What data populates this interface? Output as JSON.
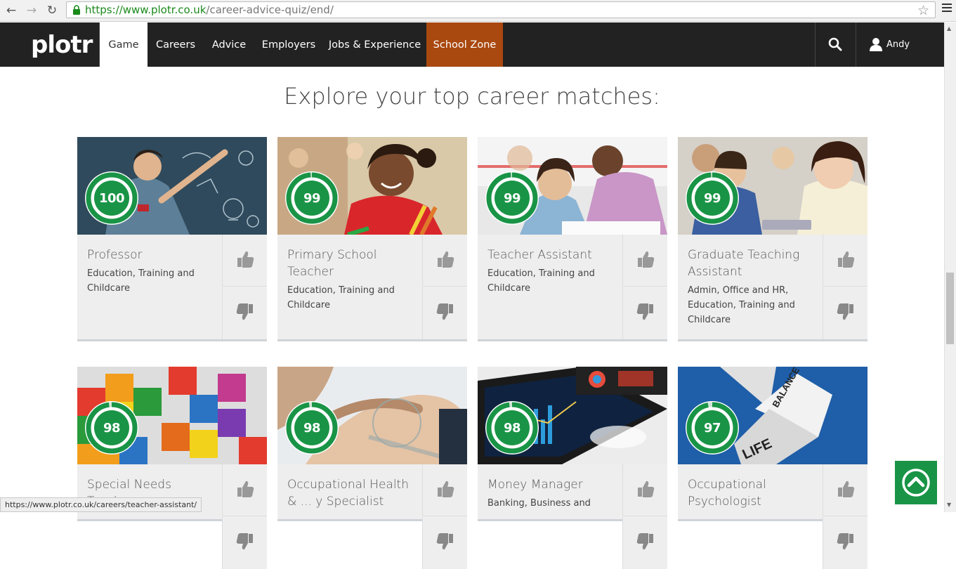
{
  "browser": {
    "url_host": "https://www.plotr.co.uk",
    "url_path": "/career-advice-quiz/end/",
    "status_url": "https://www.plotr.co.uk/careers/teacher-assistant/"
  },
  "site": {
    "logo": "plotr",
    "nav": [
      {
        "label": "Game",
        "active": true
      },
      {
        "label": "Careers"
      },
      {
        "label": "Advice"
      },
      {
        "label": "Employers"
      },
      {
        "label": "Jobs & Experience"
      },
      {
        "label": "School Zone"
      }
    ],
    "user_name": "Andy",
    "icons": {
      "search": "search-icon",
      "user": "user-icon",
      "back_to_top": "arrow-up-circle-icon"
    }
  },
  "page": {
    "heading": "Explore your top career matches:"
  },
  "colors": {
    "header_bg": "#222222",
    "school_zone": "#a9480f",
    "score_green": "#199446",
    "card_bg": "#eeeeee"
  },
  "cards": [
    {
      "score": "100",
      "score_pct": 100,
      "title": "Professor",
      "category": "Education, Training and Childcare",
      "image": "teacher-at-chalkboard"
    },
    {
      "score": "99",
      "score_pct": 99,
      "title": "Primary School Teacher",
      "category": "Education, Training and Childcare",
      "image": "smiling-girl-in-class"
    },
    {
      "score": "99",
      "score_pct": 99,
      "title": "Teacher Assistant",
      "category": "Education, Training and Childcare",
      "image": "teacher-helping-student"
    },
    {
      "score": "99",
      "score_pct": 99,
      "title": "Graduate Teaching Assistant",
      "category": "Admin, Office and HR, Education, Training and Childcare",
      "image": "teacher-with-pupils"
    },
    {
      "score": "98",
      "score_pct": 98,
      "title": "Special Needs Teacher",
      "category": "",
      "image": "colourful-puzzle-cube"
    },
    {
      "score": "98",
      "score_pct": 98,
      "title": "Occupational Health & Safety Specialist",
      "title_visible": "Occupational Health & ... y Specialist",
      "category": "",
      "image": "knee-protractor"
    },
    {
      "score": "98",
      "score_pct": 98,
      "title": "Money Manager",
      "category": "Banking, Business and",
      "image": "tablet-with-charts"
    },
    {
      "score": "97",
      "score_pct": 97,
      "title": "Occupational Psychologist",
      "category": "",
      "image": "life-balance-fortune-teller"
    }
  ]
}
